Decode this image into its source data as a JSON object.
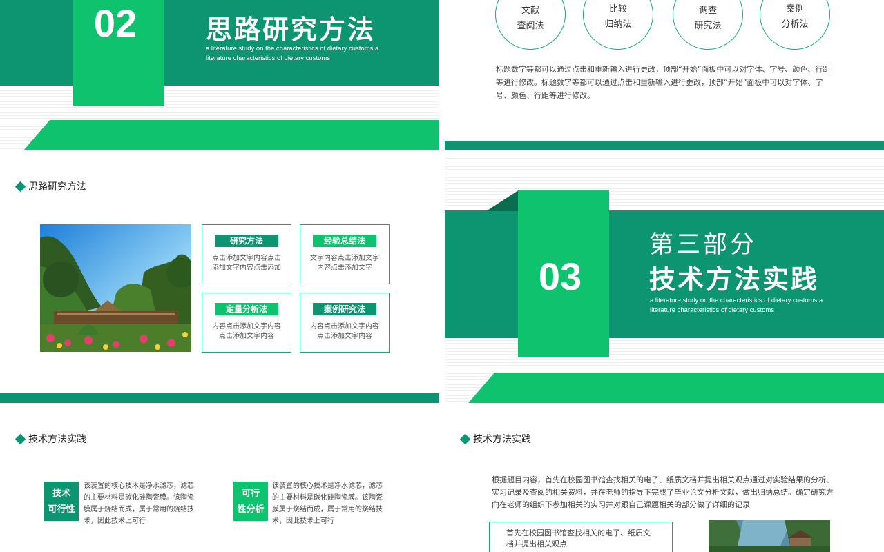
{
  "slide1": {
    "number": "02",
    "title": "思路研究方法",
    "subtitle": "a literature study on the characteristics of dietary customs a literature characteristics of dietary customs"
  },
  "slide2": {
    "circles": [
      "文献\n查阅法",
      "比较\n归纳法",
      "调查\n研究法",
      "案例\n分析法"
    ],
    "circle_lines": [
      [
        "文献",
        "查阅法"
      ],
      [
        "比较",
        "归纳法"
      ],
      [
        "调查",
        "研究法"
      ],
      [
        "案例",
        "分析法"
      ]
    ],
    "paragraph": "标题数字等都可以通过点击和重新输入进行更改，顶部“开始”面板中可以对字体、字号、颜色、行距等进行修改。标题数字等都可以通过点击和重新输入进行更改，顶部“开始”面板中可以对字体、字号、颜色、行距等进行修改。"
  },
  "slide3": {
    "heading": "思路研究方法",
    "photo_icon": "garden-photo",
    "cards": [
      {
        "tag": "研究方法",
        "text": "点击添加文字内容点击添加文字内容点击添加"
      },
      {
        "tag": "经验总结法",
        "text": "文字内容点击添加文字内容点击添加文字"
      },
      {
        "tag": "定量分析法",
        "text": "内容点击添加文字内容点击添加文字内容"
      },
      {
        "tag": "案例研究法",
        "text": "内容点击添加文字内容点击添加文字内容"
      }
    ]
  },
  "slide4": {
    "number": "03",
    "part": "第三部分",
    "title": "技术方法实践",
    "subtitle": "a literature study on the characteristics of dietary customs a literature characteristics of dietary customs"
  },
  "slide5": {
    "heading": "技术方法实践",
    "blocks": [
      {
        "tag_line1": "技术",
        "tag_line2": "可行性",
        "text": "该装置的核心技术是净水滤芯，滤芯的主要材料是碳化硅陶瓷膜。该陶瓷膜属于烧结而成，属于常用的烧结技术，因此技术上可行"
      },
      {
        "tag_line1": "可行",
        "tag_line2": "性分析",
        "text": "该装置的核心技术是净水滤芯，滤芯的主要材料是碳化硅陶瓷膜。该陶瓷膜属于烧结而成，属于常用的烧结技术，因此技术上可行"
      }
    ]
  },
  "slide6": {
    "heading": "技术方法实践",
    "paragraph": "根据题目内容，首先在校园图书馆查找相关的电子、纸质文档并提出相关观点通过对实验结果的分析、实习记录及查阅的相关资料，并在老师的指导下完成了毕业论文分析文献，做出归纳总结。确定研究方向在老师的组织下参加相关的实习并对跟自己课题相关的部分做了详细的记录",
    "box_text": "首先在校园图书馆查找相关的电子、纸质文档并提出相关观点",
    "photo_icon": "mountain-village-photo"
  },
  "colors": {
    "teal": "#0d9471",
    "green": "#0fc26e",
    "divider": "#e6e6e6"
  }
}
